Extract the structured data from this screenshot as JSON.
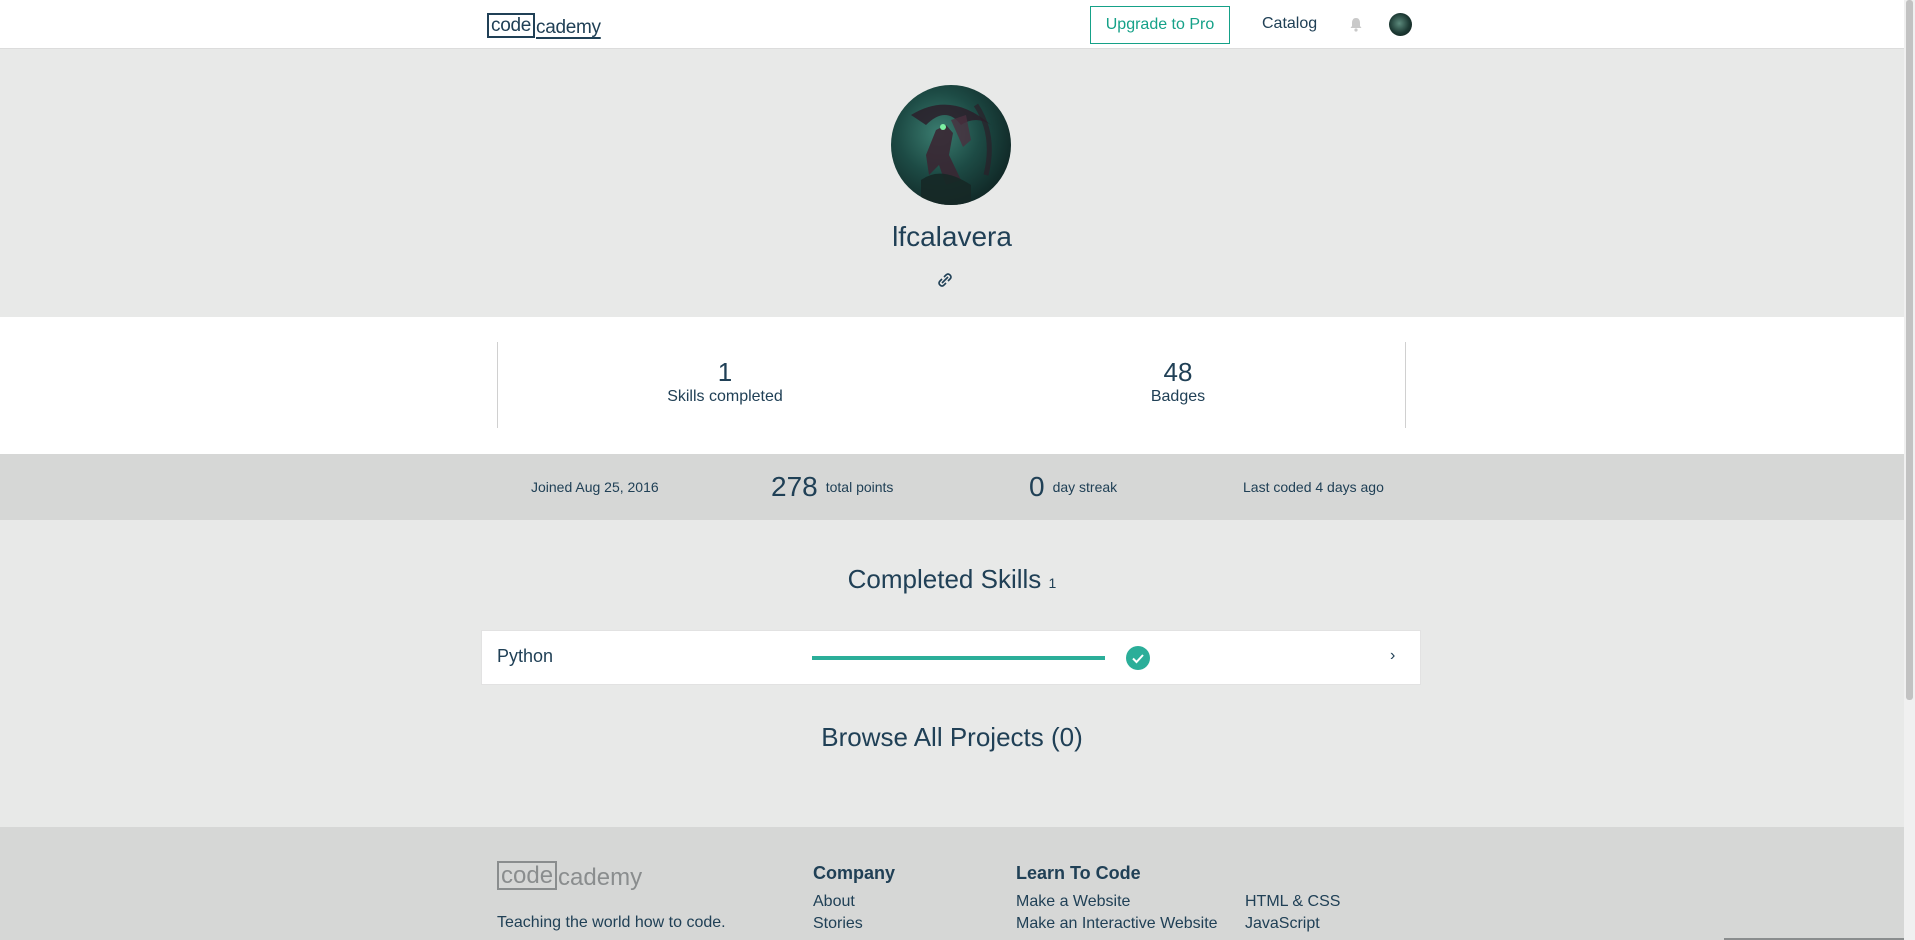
{
  "header": {
    "logo_boxed": "code",
    "logo_rest": "cademy",
    "upgrade_label": "Upgrade to Pro",
    "catalog_label": "Catalog"
  },
  "profile": {
    "username": "lfcalavera"
  },
  "counts": {
    "skills_value": "1",
    "skills_label": "Skills completed",
    "badges_value": "48",
    "badges_label": "Badges"
  },
  "stats": {
    "joined": "Joined Aug 25, 2016",
    "points_value": "278",
    "points_label": "total points",
    "streak_value": "0",
    "streak_label": "day streak",
    "last_coded": "Last coded 4 days ago"
  },
  "completed_skills": {
    "title": "Completed Skills",
    "count": "1",
    "items": [
      {
        "name": "Python",
        "progress": 1.0
      }
    ]
  },
  "projects": {
    "title": "Browse All Projects (0)"
  },
  "footer": {
    "logo_boxed": "code",
    "logo_rest": "cademy",
    "tagline": "Teaching the world how to code.",
    "company_title": "Company",
    "company_links": [
      "About",
      "Stories"
    ],
    "learn_title": "Learn To Code",
    "learn_links": [
      "Make a Website",
      "Make an Interactive Website"
    ],
    "learn_links_2": [
      "HTML & CSS",
      "JavaScript"
    ]
  },
  "colors": {
    "accent": "#15a188",
    "text": "#204056",
    "page_bg": "#e8e9e8",
    "stats_bg": "#d6d7d6"
  }
}
